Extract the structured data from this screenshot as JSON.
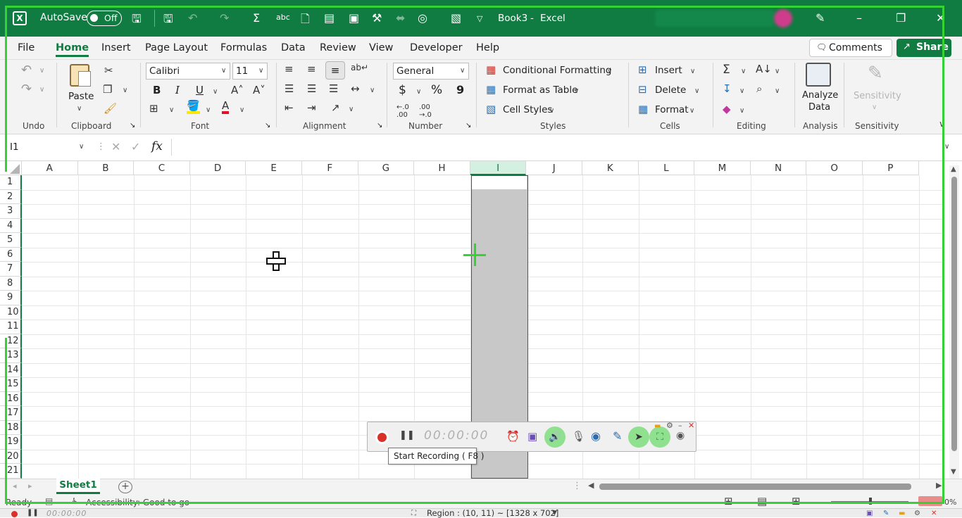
{
  "titlebar": {
    "autosave_label": "AutoSave",
    "autosave_state": "Off",
    "doc_title": "Book3",
    "separator": "-",
    "app_name": "Excel"
  },
  "menu": {
    "items": [
      "File",
      "Home",
      "Insert",
      "Page Layout",
      "Formulas",
      "Data",
      "Review",
      "View",
      "Developer",
      "Help"
    ],
    "active": "Home",
    "comments_label": "Comments",
    "share_label": "Share"
  },
  "ribbon": {
    "undo_group": "Undo",
    "clipboard_group": "Clipboard",
    "paste_label": "Paste",
    "font_group": "Font",
    "font_name": "Calibri",
    "font_size": "11",
    "bold": "B",
    "italic": "I",
    "underline": "U",
    "alignment_group": "Alignment",
    "number_group": "Number",
    "number_format": "General",
    "currency": "$",
    "percent": "%",
    "comma": "9",
    "styles_group": "Styles",
    "conditional_formatting": "Conditional Formatting",
    "format_as_table": "Format as Table",
    "cell_styles": "Cell Styles",
    "cells_group": "Cells",
    "insert": "Insert",
    "delete": "Delete",
    "format": "Format",
    "editing_group": "Editing",
    "analysis_group": "Analysis",
    "analyze_data_1": "Analyze",
    "analyze_data_2": "Data",
    "sensitivity_group": "Sensitivity",
    "sensitivity_label": "Sensitivity"
  },
  "formula_bar": {
    "name_box": "I1",
    "fx": "fx",
    "value": ""
  },
  "grid": {
    "columns": [
      "A",
      "B",
      "C",
      "D",
      "E",
      "F",
      "G",
      "H",
      "I",
      "J",
      "K",
      "L",
      "M",
      "N",
      "O",
      "P"
    ],
    "rows": [
      "1",
      "2",
      "3",
      "4",
      "5",
      "6",
      "7",
      "8",
      "9",
      "10",
      "11",
      "12",
      "13",
      "14",
      "15",
      "16",
      "17",
      "18",
      "19",
      "20",
      "21"
    ],
    "selected_column": "I",
    "selected_cell": "I1"
  },
  "sheets": {
    "tabs": [
      "Sheet1"
    ],
    "active": "Sheet1"
  },
  "status": {
    "ready": "Ready",
    "accessibility": "Accessibility: Good to go",
    "zoom_suffix": "0%"
  },
  "recorder": {
    "timer": "00:00:00",
    "tooltip": "Start Recording ( F8 )",
    "bottom_timer": "00:00:00",
    "region_text": "Region : (10, 11) ~ [1328 x 702]"
  },
  "colors": {
    "excel_green": "#107c41",
    "overlay_green": "#34d234",
    "selection_grey": "#c8c8c8",
    "record_red": "#d9302a"
  }
}
